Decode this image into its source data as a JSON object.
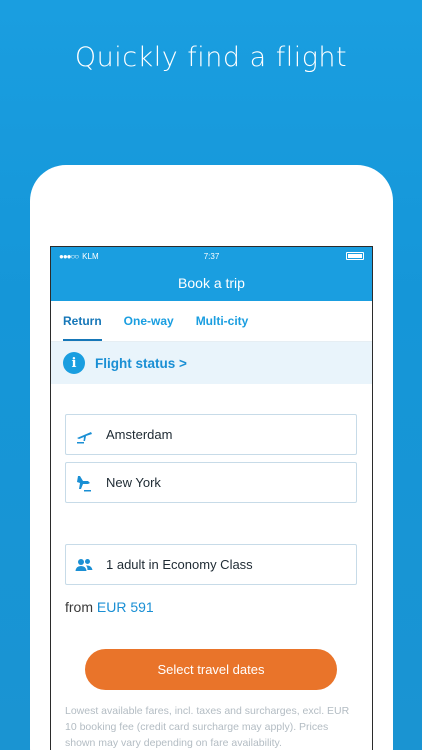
{
  "headline": "Quickly find a flight",
  "status_bar": {
    "carrier": "KLM",
    "time": "7:37"
  },
  "nav": {
    "title": "Book a trip"
  },
  "tabs": [
    {
      "label": "Return",
      "active": true
    },
    {
      "label": "One-way",
      "active": false
    },
    {
      "label": "Multi-city",
      "active": false
    }
  ],
  "flight_status": {
    "label": "Flight status >"
  },
  "origin": {
    "value": "Amsterdam"
  },
  "destination": {
    "value": "New York"
  },
  "passengers": {
    "value": "1 adult in Economy Class"
  },
  "price": {
    "prefix": "from",
    "amount": "EUR 591"
  },
  "cta": {
    "label": "Select travel dates"
  },
  "footnote": "Lowest available fares, incl. taxes and surcharges, excl. EUR 10 booking fee (credit card surcharge may apply). Prices shown may vary depending on fare availability.",
  "colors": {
    "brand_blue": "#1a9ee0",
    "cta_orange": "#e9742a"
  },
  "icons": [
    "info-icon",
    "takeoff-icon",
    "landing-icon",
    "people-icon",
    "battery-icon"
  ]
}
